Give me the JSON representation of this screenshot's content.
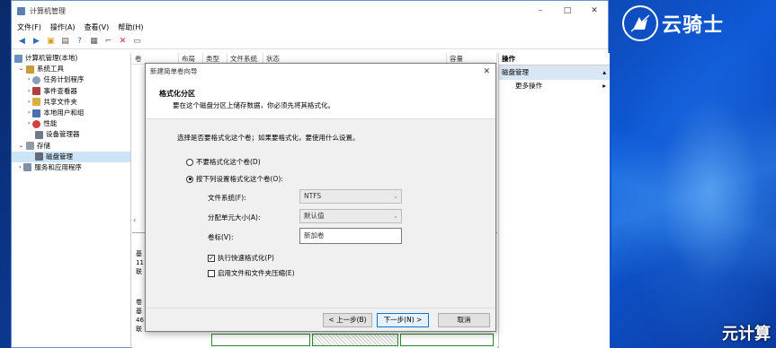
{
  "window": {
    "title": "计算机管理",
    "controls": [
      "–",
      "□",
      "✕"
    ]
  },
  "menu": [
    "文件(F)",
    "操作(A)",
    "查看(V)",
    "帮助(H)"
  ],
  "tree": [
    {
      "label": "计算机管理(本地)",
      "indent": 0
    },
    {
      "label": "系统工具",
      "indent": 1
    },
    {
      "label": "任务计划程序",
      "indent": 2
    },
    {
      "label": "事件查看器",
      "indent": 2
    },
    {
      "label": "共享文件夹",
      "indent": 2
    },
    {
      "label": "本地用户和组",
      "indent": 2
    },
    {
      "label": "性能",
      "indent": 2
    },
    {
      "label": "设备管理器",
      "indent": 2
    },
    {
      "label": "存储",
      "indent": 1
    },
    {
      "label": "磁盘管理",
      "indent": 2,
      "selected": true
    },
    {
      "label": "服务和应用程序",
      "indent": 1
    }
  ],
  "columns": [
    "卷",
    "布局",
    "类型",
    "文件系统",
    "状态",
    "容量"
  ],
  "disk_fragments": {
    "a": "基",
    "b": "11",
    "c": "联",
    "d": "卷",
    "e": "基",
    "f": "46",
    "g": "联"
  },
  "actions": {
    "header": "操作",
    "section": "磁盘管理",
    "more": "更多操作"
  },
  "dialog": {
    "title": "新建简单卷向导",
    "heading": "格式化分区",
    "subheading": "要在这个磁盘分区上储存数据，你必须先将其格式化。",
    "instruction": "选择是否要格式化这个卷；如果要格式化，要使用什么设置。",
    "radio_no": "不要格式化这个卷(D)",
    "radio_yes": "按下列设置格式化这个卷(O):",
    "fs_label": "文件系统(F):",
    "fs_value": "NTFS",
    "alloc_label": "分配单元大小(A):",
    "alloc_value": "默认值",
    "vol_label": "卷标(V):",
    "vol_value": "新加卷",
    "quick_format": "执行快速格式化(P)",
    "compress": "启用文件和文件夹压缩(E)",
    "back": "< 上一步(B)",
    "next": "下一步(N) >",
    "cancel": "取消"
  },
  "brand": {
    "name": "云骑士",
    "watermark": "元计算"
  }
}
